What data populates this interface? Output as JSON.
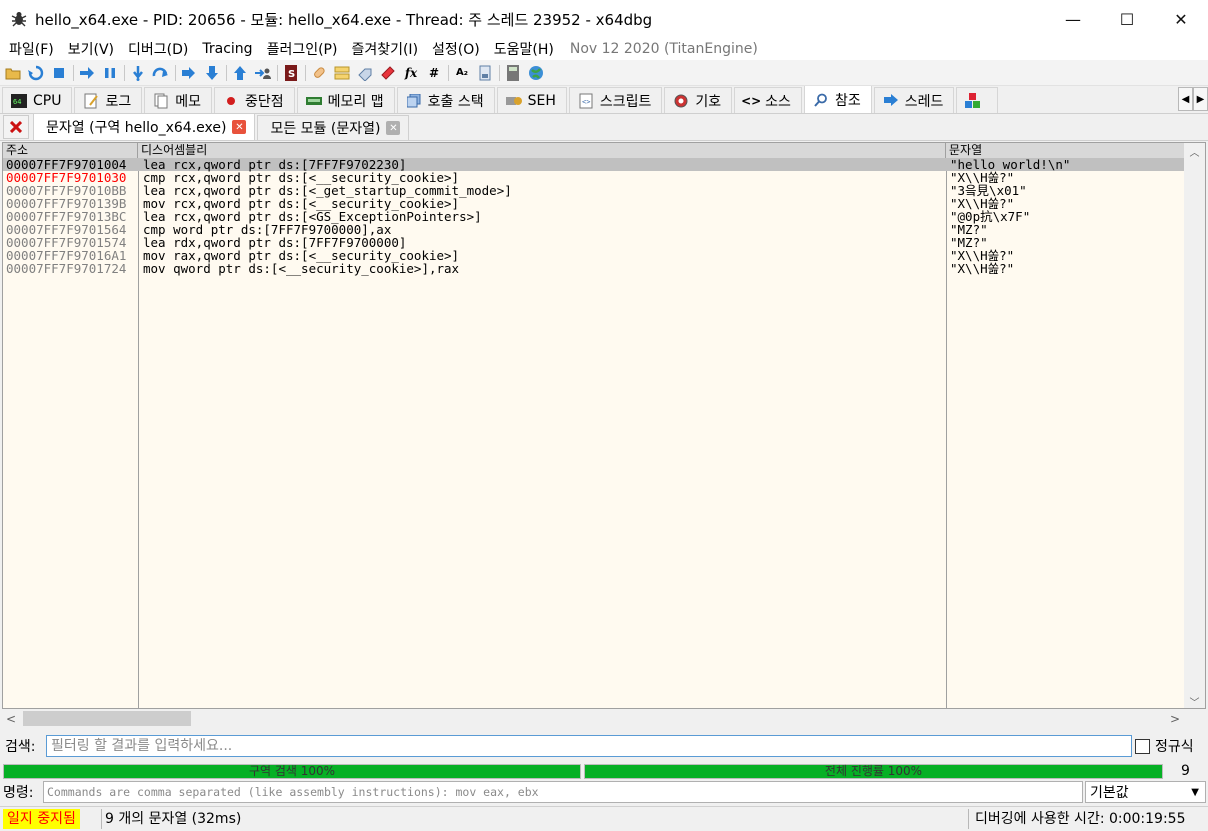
{
  "window": {
    "title": "hello_x64.exe - PID: 20656 - 모듈: hello_x64.exe - Thread: 주 스레드 23952 - x64dbg",
    "controls": {
      "minimize": "—",
      "maximize": "☐",
      "close": "✕"
    }
  },
  "menu": {
    "items": [
      "파일(F)",
      "보기(V)",
      "디버그(D)",
      "Tracing",
      "플러그인(P)",
      "즐겨찾기(I)",
      "설정(O)",
      "도움말(H)"
    ],
    "date": "Nov 12 2020 (TitanEngine)"
  },
  "main_tabs": [
    {
      "label": "CPU",
      "icon": "cpu-icon"
    },
    {
      "label": "로그",
      "icon": "log-icon"
    },
    {
      "label": "메모",
      "icon": "notes-icon"
    },
    {
      "label": "중단점",
      "icon": "breakpoint-icon"
    },
    {
      "label": "메모리 맵",
      "icon": "memory-map-icon"
    },
    {
      "label": "호출 스택",
      "icon": "call-stack-icon"
    },
    {
      "label": "SEH",
      "icon": "seh-icon"
    },
    {
      "label": "스크립트",
      "icon": "script-icon"
    },
    {
      "label": "기호",
      "icon": "symbols-icon"
    },
    {
      "label": "소스",
      "icon": "source-icon"
    },
    {
      "label": "참조",
      "icon": "references-icon",
      "active": true
    },
    {
      "label": "스레드",
      "icon": "threads-icon"
    }
  ],
  "sub_tabs": [
    {
      "label": "문자열 (구역 hello_x64.exe)",
      "active": true
    },
    {
      "label": "모든 모듈 (문자열)",
      "active": false
    }
  ],
  "table": {
    "headers": {
      "address": "주소",
      "disassembly": "디스어셈블리",
      "string": "문자열"
    },
    "rows": [
      {
        "address": "00007FF7F9701004",
        "disassembly": "lea rcx,qword ptr ds:[7FF7F9702230]",
        "string": "\"hello world!\\n\""
      },
      {
        "address": "00007FF7F9701030",
        "disassembly": "cmp rcx,qword ptr ds:[<__security_cookie>]",
        "string": "\"X\\\\H쏦?\""
      },
      {
        "address": "00007FF7F97010BB",
        "disassembly": "lea rcx,qword ptr ds:[<_get_startup_commit_mode>]",
        "string": "\"3읔見\\x01\""
      },
      {
        "address": "00007FF7F970139B",
        "disassembly": "mov rcx,qword ptr ds:[<__security_cookie>]",
        "string": "\"X\\\\H쏦?\""
      },
      {
        "address": "00007FF7F97013BC",
        "disassembly": "lea rcx,qword ptr ds:[<GS_ExceptionPointers>]",
        "string": "\"@0p抗\\x7F\""
      },
      {
        "address": "00007FF7F9701564",
        "disassembly": "cmp word ptr ds:[7FF7F9700000],ax",
        "string": "\"MZ?\""
      },
      {
        "address": "00007FF7F9701574",
        "disassembly": "lea rdx,qword ptr ds:[7FF7F9700000]",
        "string": "\"MZ?\""
      },
      {
        "address": "00007FF7F97016A1",
        "disassembly": "mov rax,qword ptr ds:[<__security_cookie>]",
        "string": "\"X\\\\H쏦?\""
      },
      {
        "address": "00007FF7F9701724",
        "disassembly": "mov qword ptr ds:[<__security_cookie>],rax",
        "string": "\"X\\\\H쏦?\""
      }
    ]
  },
  "search": {
    "label": "검색:",
    "placeholder": "필터링 할 결과를 입력하세요...",
    "regex_label": "정규식"
  },
  "progress": {
    "region_label": "구역 검색 100%",
    "region_value": 1.0,
    "total_label": "전체 진행률 100%",
    "total_value": 1.0,
    "count": "9"
  },
  "command": {
    "label": "명령:",
    "placeholder": "Commands are comma separated (like assembly instructions): mov eax, ebx",
    "mode": "기본값"
  },
  "status": {
    "state": "일지 중지됨",
    "message": "9 개의 문자열 (32ms)",
    "time": "디버깅에 사용한 시간: 0:00:19:55"
  },
  "colors": {
    "progress_fill": "#06b025",
    "paused_bg": "#ffff00",
    "paused_text": "#ff0000",
    "table_bg": "#fffaf0",
    "selected_row": "#c0c0c0"
  }
}
